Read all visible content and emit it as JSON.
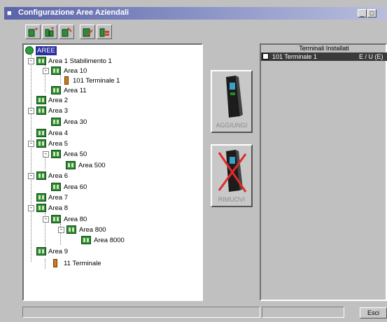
{
  "window": {
    "title": "Configurazione Aree Aziendali",
    "title_bar_colors": [
      "#5a63a8",
      "#b9bedd"
    ],
    "buttons": [
      "minimize",
      "maximize"
    ]
  },
  "toolbar": {
    "buttons": [
      {
        "icon": "add-area-icon"
      },
      {
        "icon": "add-subarea-icon"
      },
      {
        "icon": "delete-area-icon"
      },
      {
        "icon": "edit-area-icon"
      },
      {
        "icon": "properties-icon"
      }
    ]
  },
  "tree": {
    "root": "AREE",
    "nodes": [
      {
        "label": "Area 1 Stabilimento 1"
      },
      {
        "label": "Area 10"
      },
      {
        "label": "101 Terminale 1"
      },
      {
        "label": "Area 11"
      },
      {
        "label": "Area 2"
      },
      {
        "label": "Area 3"
      },
      {
        "label": "Area 30"
      },
      {
        "label": "Area 4"
      },
      {
        "label": "Area 5"
      },
      {
        "label": "Area 50"
      },
      {
        "label": "Area 500"
      },
      {
        "label": "Area 6"
      },
      {
        "label": "Area 60"
      },
      {
        "label": "Area 7"
      },
      {
        "label": "Area 8"
      },
      {
        "label": "Area 80"
      },
      {
        "label": "Area 800"
      },
      {
        "label": "Area 8000"
      },
      {
        "label": "Area 9"
      },
      {
        "label": "11 Terminale"
      }
    ]
  },
  "actions": {
    "add_label": "AGGIUNGI",
    "remove_label": "RIMUOVI"
  },
  "installed": {
    "header": "Terminali Installati",
    "rows": [
      {
        "name": "101 Terminale 1",
        "mode": "E / U (E)"
      }
    ]
  },
  "footer": {
    "exit_label": "Esci"
  }
}
